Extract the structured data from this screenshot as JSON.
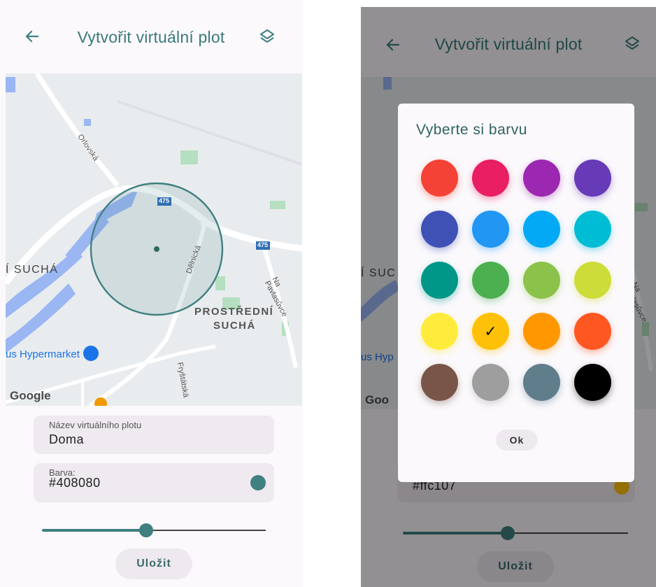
{
  "left": {
    "appbar": {
      "title": "Vytvořit virtuální plot",
      "back_icon": "arrow-left-icon",
      "layers_icon": "layers-icon"
    },
    "map": {
      "labels": {
        "area_1": "Í SUCHÁ",
        "area_2_line1": "PROSTŘEDNÍ",
        "area_2_line2": "SUCHÁ",
        "road_1": "Orlovská",
        "road_2": "Dělnická",
        "road_3": "Na Pavlasůvce",
        "road_4": "Fryštátská",
        "shield_1": "475",
        "shield_2": "475",
        "poi": "us Hypermarket",
        "google": "Google"
      },
      "fence_color": "#408080"
    },
    "name_field": {
      "label": "Název virtuálního plotu",
      "value": "Doma"
    },
    "color_field": {
      "label": "Barva:",
      "value": "#408080",
      "swatch": "#408080"
    },
    "slider": {
      "value": 0.47
    },
    "save_label": "Uložit"
  },
  "right": {
    "appbar": {
      "title": "Vytvořit virtuální plot"
    },
    "map": {
      "area_1": "Í SUC",
      "poi": "us Hyp",
      "google": "Goo",
      "road_3": "Na Pavlasůvce"
    },
    "color_field": {
      "value": "#ffc107",
      "swatch": "#ffc107"
    },
    "slider": {
      "value": 0.47
    },
    "save_label": "Uložit",
    "dialog": {
      "title": "Vyberte si barvu",
      "ok_label": "Ok",
      "selected": "#ffc107",
      "colors": [
        "#f44336",
        "#e91e63",
        "#9c27b0",
        "#673ab7",
        "#3f51b5",
        "#2196f3",
        "#03a9f4",
        "#00bcd4",
        "#009688",
        "#4caf50",
        "#8bc34a",
        "#cddc39",
        "#ffeb3b",
        "#ffc107",
        "#ff9800",
        "#ff5722",
        "#795548",
        "#9e9e9e",
        "#607d8b",
        "#000000"
      ]
    }
  }
}
